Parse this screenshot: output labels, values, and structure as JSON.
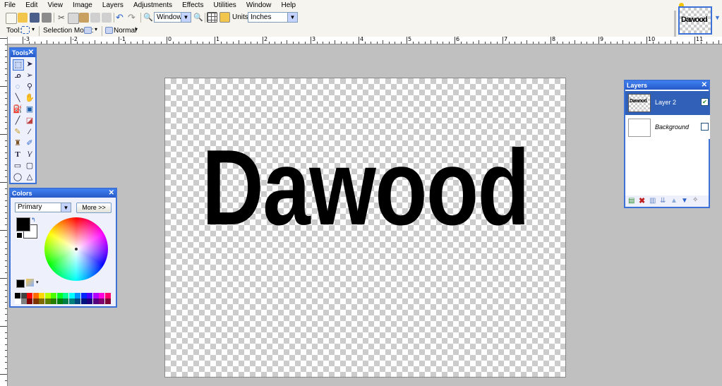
{
  "menu": [
    "File",
    "Edit",
    "View",
    "Image",
    "Layers",
    "Adjustments",
    "Effects",
    "Utilities",
    "Window",
    "Help"
  ],
  "toolbar": {
    "zoom_value": "Window",
    "units_label": "Units:",
    "units_value": "Inches",
    "tool_label": "Tool:",
    "selection_mode_label": "Selection Mode:",
    "blend_mode_value": "Normal"
  },
  "thumbnail": {
    "text": "Dawood"
  },
  "ruler": {
    "h_labels": [
      "-3",
      "-2",
      "-1",
      "0",
      "1",
      "2",
      "3",
      "4",
      "5",
      "6",
      "7",
      "8",
      "9",
      "10",
      "11"
    ]
  },
  "canvas": {
    "text": "Dawood"
  },
  "tools_panel": {
    "title": "Tools"
  },
  "colors_panel": {
    "title": "Colors",
    "mode_value": "Primary",
    "more_button": "More >>",
    "primary_color": "#000000",
    "secondary_color": "#ffffff"
  },
  "layers_panel": {
    "title": "Layers",
    "layers": [
      {
        "name": "Layer 2",
        "thumb_text": "Dawood",
        "visible": true,
        "selected": true
      },
      {
        "name": "Background",
        "thumb_text": "",
        "visible": false,
        "selected": false
      }
    ]
  },
  "palette": [
    "#000000",
    "#404040",
    "#ff0000",
    "#ff6a00",
    "#ffd800",
    "#b6ff00",
    "#4cff00",
    "#00ff21",
    "#00ff90",
    "#00ffff",
    "#0094ff",
    "#0026ff",
    "#4800ff",
    "#b200ff",
    "#ff00dc",
    "#ff006e",
    "#ffffff",
    "#808080",
    "#7f0000",
    "#7f3300",
    "#7f6a00",
    "#5b7f00",
    "#267f00",
    "#007f0e",
    "#007f46",
    "#007f7f",
    "#004a7f",
    "#00137f",
    "#21007f",
    "#57007f",
    "#7f006e",
    "#7f0037"
  ]
}
